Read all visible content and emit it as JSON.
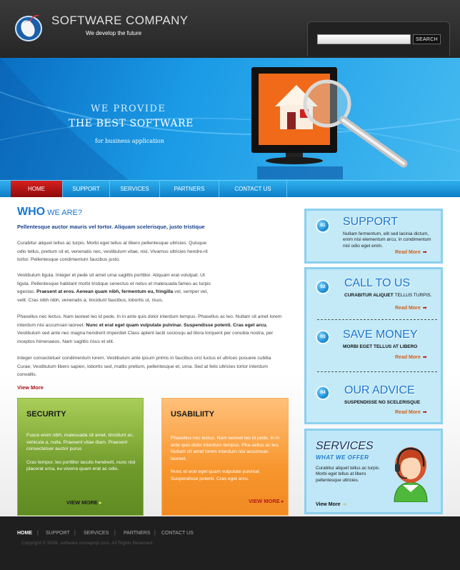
{
  "header": {
    "company": "SOFTWARE COMPANY",
    "tagline": "We develop the future",
    "search_placeholder": "",
    "search_button": "SEARCH"
  },
  "banner": {
    "line1": "WE PROVIDE",
    "line2": "THE BEST SOFTWARE",
    "line3": "for business application"
  },
  "nav": {
    "items": [
      "HOME",
      "SUPPORT",
      "SERVICES",
      "PARTNERS",
      "CONTACT US"
    ],
    "active": "HOME"
  },
  "main": {
    "who_title_big": "WHO",
    "who_title_small": "WE ARE?",
    "who_subtitle": "Pellentesque auctor mauris vel tortor. Aliquam scelerisque, justo tristique",
    "para1": "Curabitur aliquet tellus ac turpis. Morbi eget tellus at libero pellentesque ultricies. Quisque odio tellus, pretium sit et, venenatis nec, vestibulum vitae, nisi. Vivamus ultricies hendre-rit tortor. Pellentesque condimentum faucibus justo.",
    "para2_pre": "Vestibulum ligula. Integer et pede sit amet urna sagittis porttitor. Aliquam erat volutpat. Ut ligula. Pellentesque habitant morbi tristique senectus et netus et malesuada fames ac turpis egestas.",
    "para2_bold": "Praesent at eros. Aenean quam nibh, fermentum eu, fringilla",
    "para2_post": "vel, semper vel, velit. Cras nibh nibh, venenatis a, tincidunt faucibus, lobortis ut, risus.",
    "para3_pre": "Phasellus nec lectus. Nam laoreet leo id pede. In in ante quis dolor interdum tempus. Phasellus ac leo. Nullam sit amet lorem interdum nisi accumsan laoreet.",
    "para3_bold": "Nunc et erat eget quam vulputate pulvinar. Suspendisse potenti. Cras eget arcu.",
    "para3_post": "Vestibulum sed ante nec magna hendrerit imperdiet Class aptent taciti sociosqu ad litora torquent per conubia nostra, per inceptos himenaeos. Nam sagittis risus et elit.",
    "para4": "Integer consectetuer condimentum lorem. Vestibulum ante ipsum primis in faucibus orci luctus et ultrices posuere cubilia Curae; Vestibulum libero sapien, lobortis sed, mattis pretium, pellentesque et, urna. Sed at felis ultricies tortor interdum convallis.",
    "view_more": "View More"
  },
  "security": {
    "title": "SECURITY",
    "text1": "Fusce enim nibh, malesuada sit amet, tincidunt ac, vehicula a, nulla. Praesent vitae diam. Praesent consectetuer auctor purus",
    "text2": "Cras tempor, leo porttitor iaculis hendrerit, nunc nisl placerat urna, eu viverra quam erat ac odio.",
    "link": "VIEW MORE",
    "link_arrow": "▸"
  },
  "usability": {
    "title": "USABILIITY",
    "text1": "Phasellus nec lectus. Nam laoreet leo id pede. In in ante quis dolor interdum tempus. Pha-sellus ac leo. Nullam sit amet lorem interdum nisi accumsan laoreet.",
    "text2": "Nunc et erat eget quam vulputate pulvinar. Suspendisse potenti. Cras eget arcu.",
    "link": "VIEW MORE",
    "link_arrow": "▸"
  },
  "sidebar": {
    "support": {
      "num": "01",
      "title": "SUPPORT",
      "text": "Nullam fermentum, elit sed lacinia dictum, enim nisi elementum arcu, in condimentum nisl odio eget enim.",
      "more": "Read More",
      "arrow": "➡"
    },
    "call": {
      "num": "02",
      "title": "CALL TO US",
      "bold": "CURABITUR ALIQUET",
      "rest": "TELLUS TURPIS.",
      "more": "Read More",
      "arrow": "➡"
    },
    "save": {
      "num": "03",
      "title": "SAVE MONEY",
      "bold": "MORBI EGET TELLUS AT LIBERO",
      "more": "Read More",
      "arrow": "➡"
    },
    "advice": {
      "num": "04",
      "title": "OUR ADVICE",
      "bold": "SUSPENDISSE NO SCELERISQUE",
      "more": "Read More",
      "arrow": "➡"
    },
    "services": {
      "title": "SERVICES",
      "subtitle": "WHAT WE OFFER",
      "text": "Curabitur aliquet tellus ac turpis. Morbi eget tellus at libero pellentesque ultricies.",
      "more": "View More",
      "arrow": "➜"
    }
  },
  "footer": {
    "links": [
      "HOME",
      "SUPPORT",
      "SERVICES",
      "PARTNERS",
      "CONTACT US"
    ],
    "separator": "|",
    "copyright": "Copyright © 2008. software comapnyt.com. All Rights Reserved."
  }
}
